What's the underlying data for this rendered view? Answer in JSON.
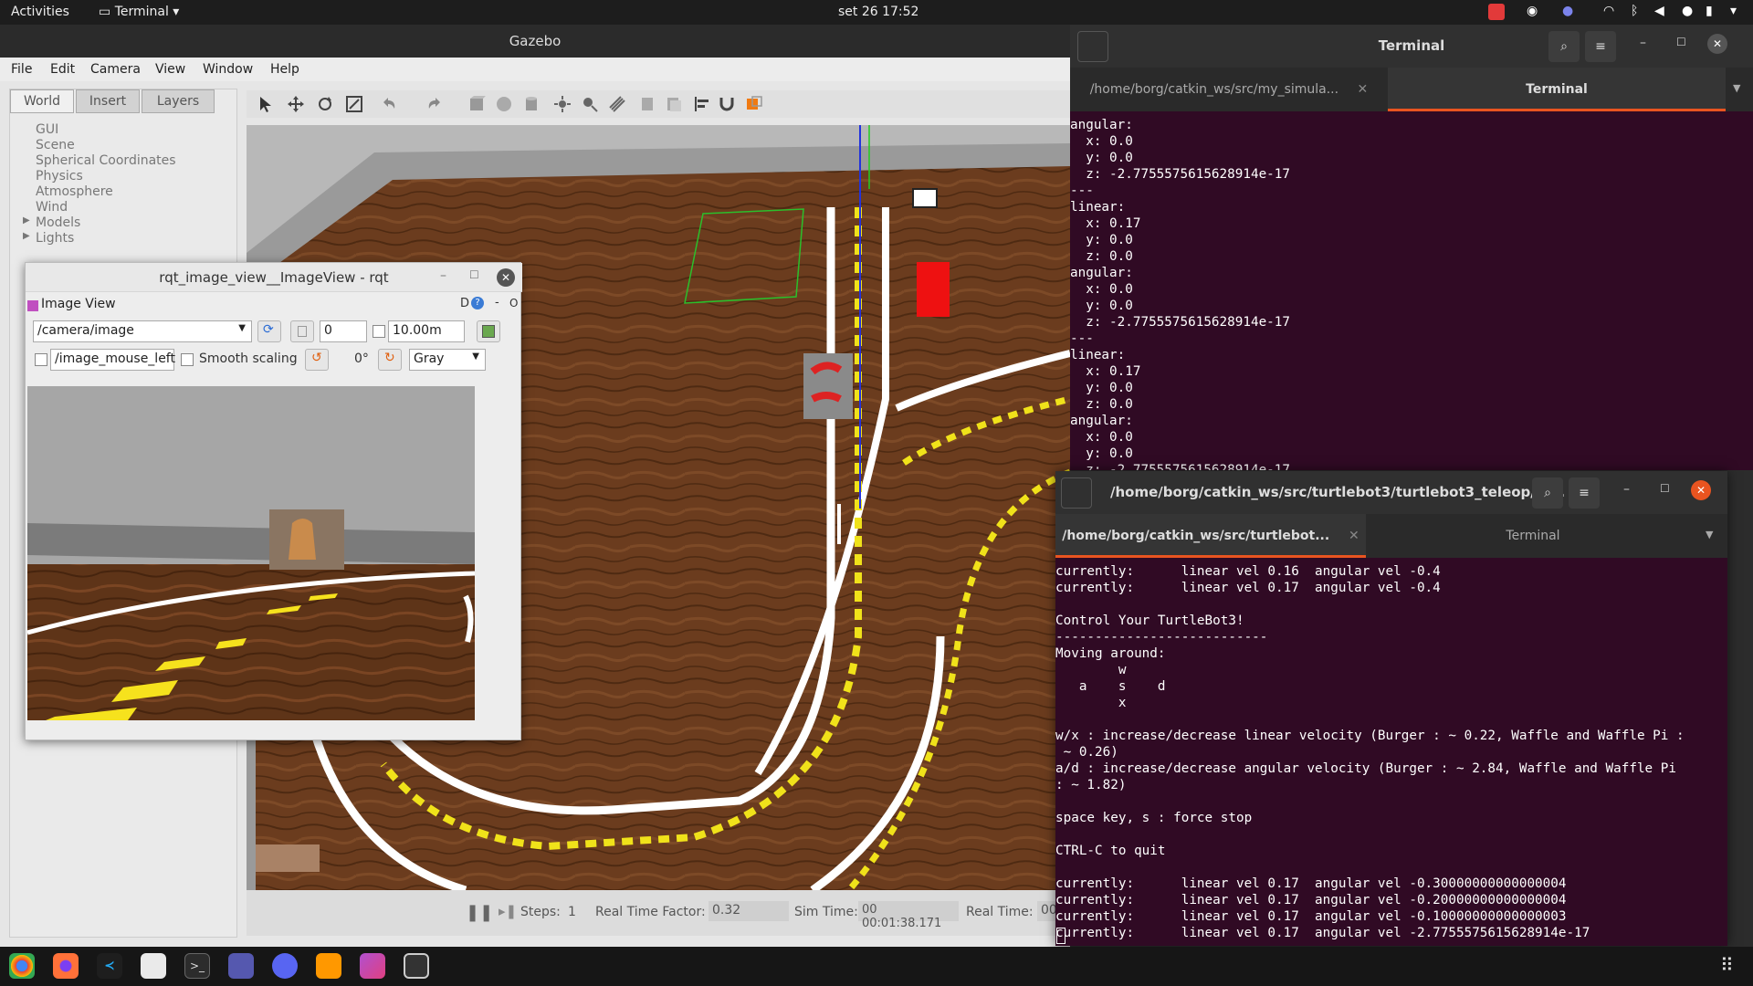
{
  "topbar": {
    "activities": "Activities",
    "app_menu": "Terminal",
    "datetime": "set 26  17:52"
  },
  "gazebo": {
    "title": "Gazebo",
    "menu": [
      "File",
      "Edit",
      "Camera",
      "View",
      "Window",
      "Help"
    ],
    "tabs": [
      "World",
      "Insert",
      "Layers"
    ],
    "tree": [
      "GUI",
      "Scene",
      "Spherical Coordinates",
      "Physics",
      "Atmosphere",
      "Wind",
      "Models",
      "Lights"
    ],
    "bottom": {
      "steps_label": "Steps:",
      "steps_value": "1",
      "rtf_label": "Real Time Factor:",
      "rtf_value": "0.32",
      "sim_label": "Sim Time:",
      "sim_value": "00 00:01:38.171",
      "real_label": "Real Time:",
      "real_value": "00"
    }
  },
  "rqt": {
    "title": "rqt_image_view__ImageView - rqt",
    "panel_title": "Image View",
    "panel_controls": "D",
    "topic": "/camera/image",
    "spin_value": "0",
    "interval": "10.00m",
    "mouse_topic": "/image_mouse_left",
    "smooth_label": "Smooth scaling",
    "rotation": "0°",
    "colormap": "Gray"
  },
  "term1": {
    "header_title": "Terminal",
    "tab1": "/home/borg/catkin_ws/src/my_simula...",
    "tab2": "Terminal",
    "lines": [
      "angular:",
      "  x: 0.0",
      "  y: 0.0",
      "  z: -2.7755575615628914e-17",
      "---",
      "linear:",
      "  x: 0.17",
      "  y: 0.0",
      "  z: 0.0",
      "angular:",
      "  x: 0.0",
      "  y: 0.0",
      "  z: -2.7755575615628914e-17",
      "---",
      "linear:",
      "  x: 0.17",
      "  y: 0.0",
      "  z: 0.0",
      "angular:",
      "  x: 0.0",
      "  y: 0.0",
      "  z: -2.7755575615628914e-17"
    ]
  },
  "term2": {
    "header_title": "/home/borg/catkin_ws/src/turtlebot3/turtlebot3_teleop/la...",
    "tab1": "/home/borg/catkin_ws/src/turtlebot...",
    "tab2": "Terminal",
    "lines": [
      "currently:      linear vel 0.16  angular vel -0.4",
      "currently:      linear vel 0.17  angular vel -0.4",
      "",
      "Control Your TurtleBot3!",
      "---------------------------",
      "Moving around:",
      "        w",
      "   a    s    d",
      "        x",
      "",
      "w/x : increase/decrease linear velocity (Burger : ~ 0.22, Waffle and Waffle Pi :",
      " ~ 0.26)",
      "a/d : increase/decrease angular velocity (Burger : ~ 2.84, Waffle and Waffle Pi",
      ": ~ 1.82)",
      "",
      "space key, s : force stop",
      "",
      "CTRL-C to quit",
      "",
      "currently:      linear vel 0.17  angular vel -0.30000000000000004",
      "currently:      linear vel 0.17  angular vel -0.20000000000000004",
      "currently:      linear vel 0.17  angular vel -0.10000000000000003",
      "currently:      linear vel 0.17  angular vel -2.7755575615628914e-17"
    ]
  },
  "dock_apps": [
    "chrome-icon",
    "firefox-icon",
    "vscode-icon",
    "files-icon",
    "terminal-icon",
    "teams-icon",
    "discord-icon",
    "sublime-icon",
    "image-viewer-icon",
    "usb-icon"
  ]
}
